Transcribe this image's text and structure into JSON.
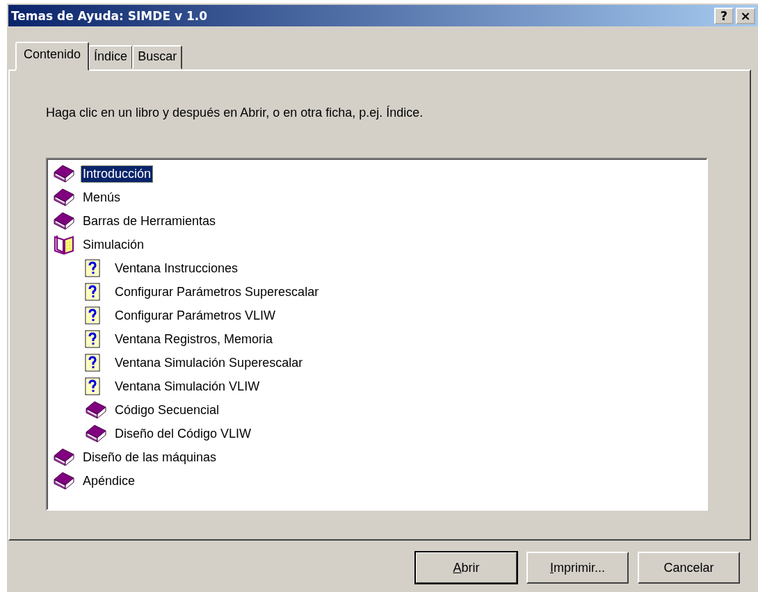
{
  "window": {
    "title": "Temas de Ayuda: SIMDE v 1.0",
    "title_buttons": [
      "?",
      "×"
    ]
  },
  "tabs": [
    {
      "label": "Contenido",
      "selected": true
    },
    {
      "label": "Índice",
      "selected": false
    },
    {
      "label": "Buscar",
      "selected": false
    }
  ],
  "instruction": "Haga clic en un libro y después en Abrir, o en otra ficha, p.ej. Índice.",
  "tree": [
    {
      "kind": "book",
      "label": "Introducción",
      "selected": true,
      "expanded": false
    },
    {
      "kind": "book",
      "label": "Menús",
      "selected": false,
      "expanded": false
    },
    {
      "kind": "book",
      "label": "Barras de Herramientas",
      "selected": false,
      "expanded": false
    },
    {
      "kind": "book",
      "label": "Simulación",
      "selected": false,
      "expanded": true,
      "children": [
        {
          "kind": "page",
          "label": "Ventana Instrucciones",
          "selected": false
        },
        {
          "kind": "page",
          "label": "Configurar Parámetros Superescalar",
          "selected": false
        },
        {
          "kind": "page",
          "label": "Configurar Parámetros VLIW",
          "selected": false
        },
        {
          "kind": "page",
          "label": "Ventana Registros, Memoria",
          "selected": false
        },
        {
          "kind": "page",
          "label": "Ventana Simulación Superescalar",
          "selected": false
        },
        {
          "kind": "page",
          "label": "Ventana Simulación VLIW",
          "selected": false
        },
        {
          "kind": "book",
          "label": "Código Secuencial",
          "selected": false,
          "expanded": false
        },
        {
          "kind": "book",
          "label": "Diseño del Código VLIW",
          "selected": false,
          "expanded": false
        }
      ]
    },
    {
      "kind": "book",
      "label": "Diseño de las máquinas",
      "selected": false,
      "expanded": false
    },
    {
      "kind": "book",
      "label": "Apéndice",
      "selected": false,
      "expanded": false
    }
  ],
  "buttons": [
    {
      "label": "Abrir",
      "default": true,
      "underline_first": true
    },
    {
      "label": "Imprimir...",
      "default": false,
      "underline_first": true
    },
    {
      "label": "Cancelar",
      "default": false,
      "underline_first": false
    }
  ]
}
